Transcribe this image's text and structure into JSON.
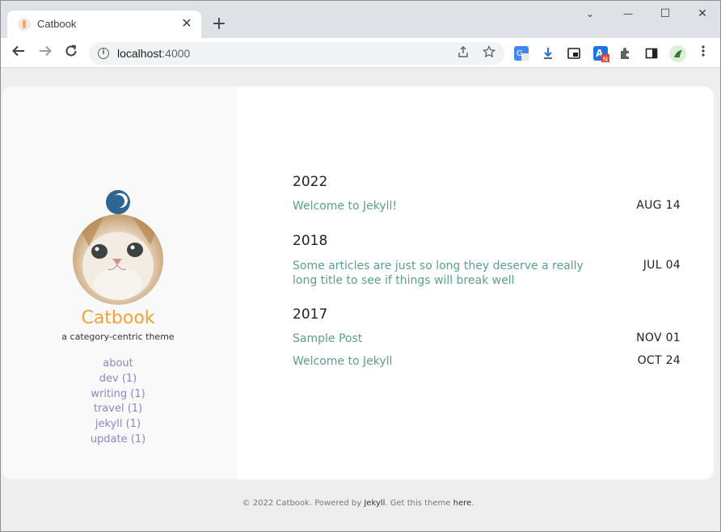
{
  "browser": {
    "tab_title": "Catbook",
    "tab_close": "✕",
    "new_tab": "+",
    "url_host": "localhost",
    "url_port": ":4000",
    "controls": {
      "minimize": "—",
      "maximize": "☐",
      "close": "✕",
      "tab_search": "⌄"
    },
    "accent_colors": {
      "translate": "#4285f4",
      "ext_a": "#1a73e8",
      "ext_badge": "#ea4335"
    }
  },
  "sidebar": {
    "title": "Catbook",
    "description": "a category-centric theme",
    "nav": [
      {
        "label": "about"
      },
      {
        "label": "dev (1)"
      },
      {
        "label": "writing (1)"
      },
      {
        "label": "travel (1)"
      },
      {
        "label": "jekyll (1)"
      },
      {
        "label": "update (1)"
      }
    ]
  },
  "posts": {
    "groups": [
      {
        "year": "2022",
        "items": [
          {
            "title": "Welcome to Jekyll!",
            "date": "AUG 14"
          }
        ]
      },
      {
        "year": "2018",
        "items": [
          {
            "title": "Some articles are just so long they deserve a really long title to see if things will break well",
            "date": "JUL 04"
          }
        ]
      },
      {
        "year": "2017",
        "items": [
          {
            "title": "Sample Post",
            "date": "NOV 01"
          },
          {
            "title": "Welcome to Jekyll",
            "date": "OCT 24"
          }
        ]
      }
    ]
  },
  "footer": {
    "prefix": "© 2022 Catbook. Powered by ",
    "jekyll": "Jekyll",
    "middle": ". Get this theme ",
    "here": "here",
    "suffix": "."
  },
  "colors": {
    "title_accent": "#f2a23a",
    "nav_link": "#8b86c9",
    "post_link": "#5aa08f"
  }
}
